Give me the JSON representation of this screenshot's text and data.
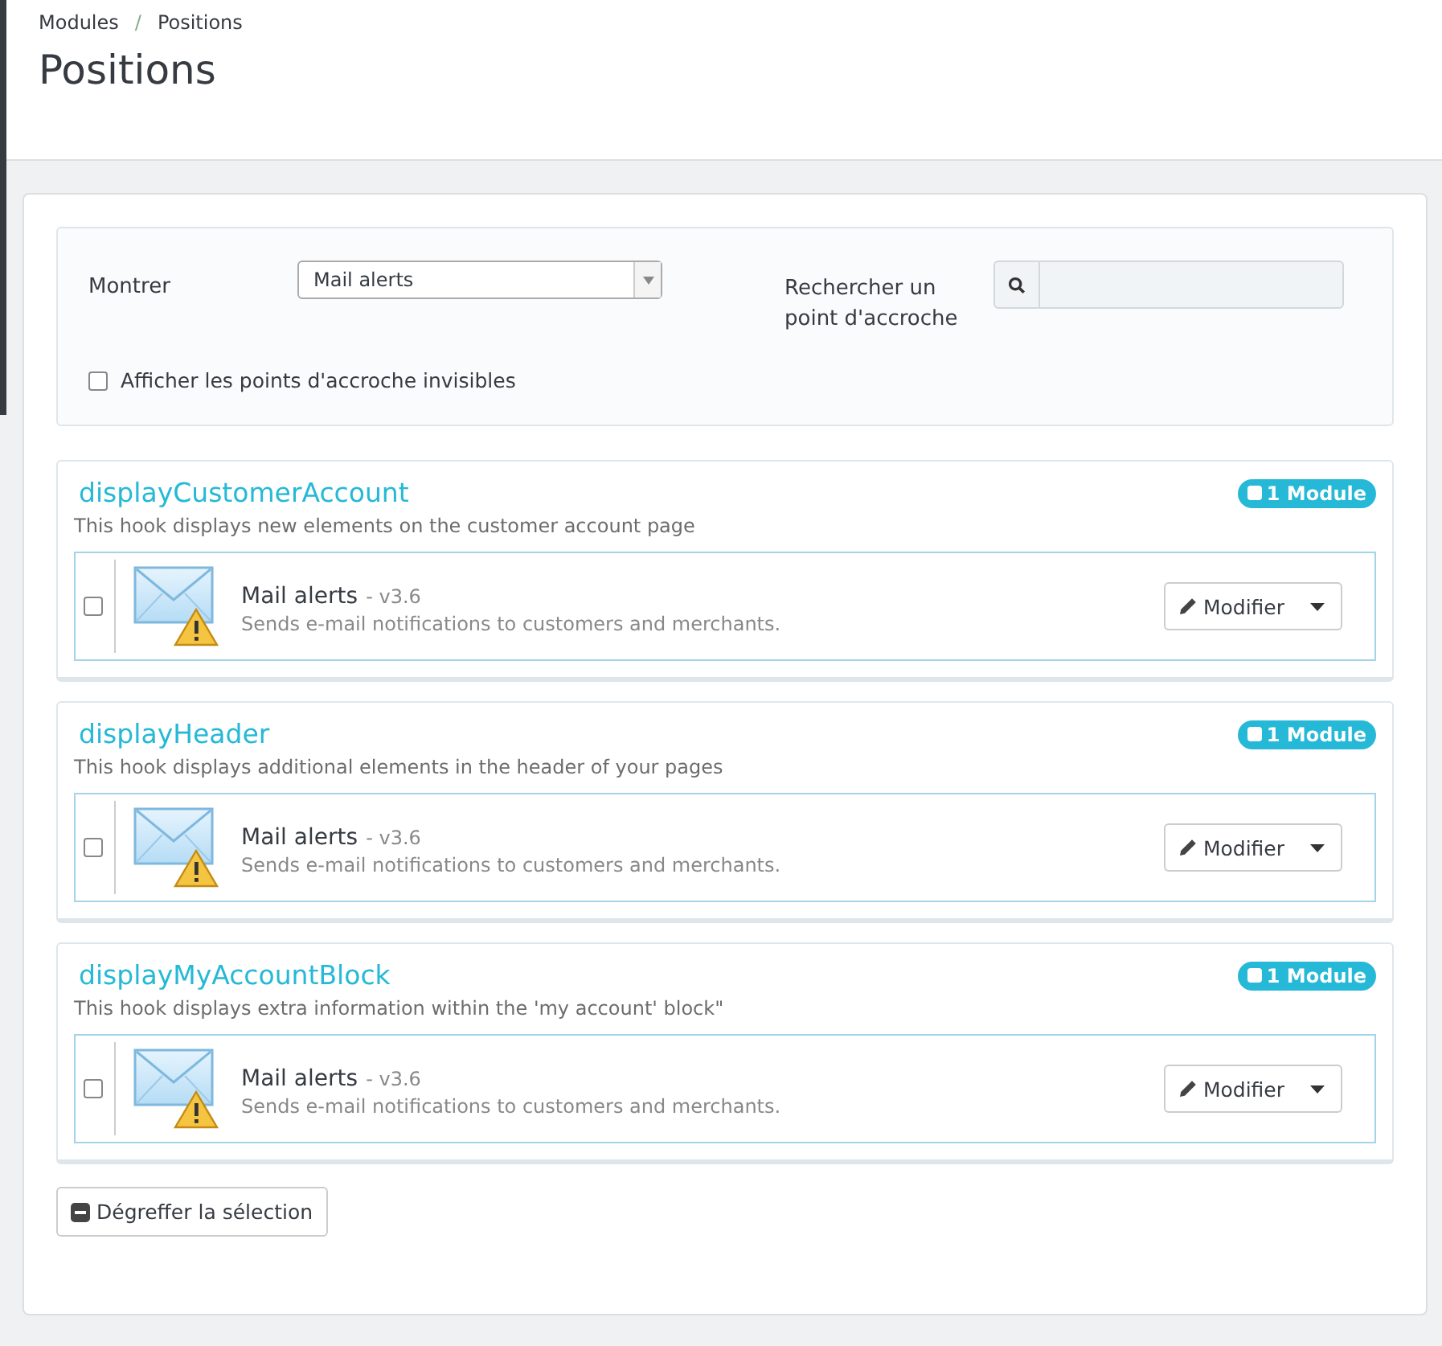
{
  "breadcrumb": [
    "Modules",
    "Positions"
  ],
  "breadcrumb_separator": "/",
  "page_title": "Positions",
  "filters": {
    "show_label": "Montrer",
    "show_value": "Mail alerts",
    "search_label": "Rechercher un point d'accroche",
    "invisible_label": "Afficher les points d'accroche invisibles",
    "invisible_checked": false
  },
  "hooks": [
    {
      "name": "displayCustomerAccount",
      "description": "This hook displays new elements on the customer account page",
      "badge": "1 Module",
      "modules": [
        {
          "name": "Mail alerts",
          "version": "- v3.6",
          "description": "Sends e-mail notifications to customers and merchants.",
          "checked": false,
          "action": "Modifier"
        }
      ]
    },
    {
      "name": "displayHeader",
      "description": "This hook displays additional elements in the header of your pages",
      "badge": "1 Module",
      "modules": [
        {
          "name": "Mail alerts",
          "version": "- v3.6",
          "description": "Sends e-mail notifications to customers and merchants.",
          "checked": false,
          "action": "Modifier"
        }
      ]
    },
    {
      "name": "displayMyAccountBlock",
      "description": "This hook displays extra information within the 'my account' block\"",
      "badge": "1 Module",
      "modules": [
        {
          "name": "Mail alerts",
          "version": "- v3.6",
          "description": "Sends e-mail notifications to customers and merchants.",
          "checked": false,
          "action": "Modifier"
        }
      ]
    }
  ],
  "unhook_button": "Dégreffer la sélection"
}
